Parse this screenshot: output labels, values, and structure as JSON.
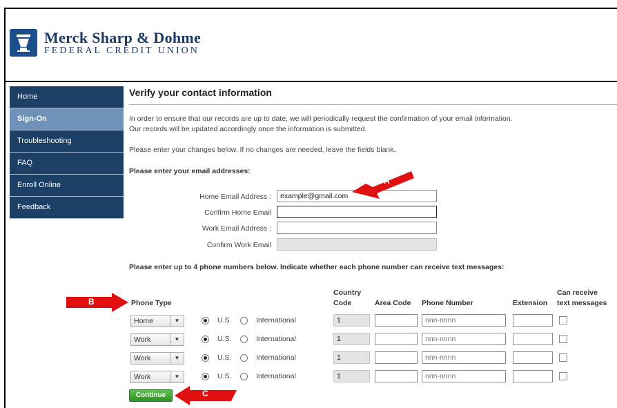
{
  "brand": {
    "name": "Merck Sharp & Dohme",
    "subtitle": "FEDERAL CREDIT UNION"
  },
  "sidebar": {
    "items": [
      {
        "label": "Home"
      },
      {
        "label": "Sign-On"
      },
      {
        "label": "Troubleshooting"
      },
      {
        "label": "FAQ"
      },
      {
        "label": "Enroll Online"
      },
      {
        "label": "Feedback"
      }
    ],
    "active_index": 1
  },
  "main": {
    "title": "Verify your contact information",
    "intro_line1": "In order to ensure that our records are up to date, we will periodically request the confirmation of your email information.",
    "intro_line2": "Our records will be updated accordingly once the information is submitted.",
    "instruction": "Please enter your changes below. If no changes are needed, leave the fields blank.",
    "email_heading": "Please enter your email addresses:",
    "email_fields": [
      {
        "label": "Home Email Address :",
        "value": "example@gmail.com"
      },
      {
        "label": "Confirm Home Email",
        "value": ""
      },
      {
        "label": "Work Email Address :",
        "value": ""
      },
      {
        "label": "Confirm Work Email",
        "value": ""
      }
    ],
    "phone_heading": "Please enter up to 4 phone numbers below. Indicate whether each phone number can receive text messages:",
    "phone_columns": {
      "type": "Phone Type",
      "country_1": "Country",
      "country_2": "Code",
      "area": "Area Code",
      "number": "Phone Number",
      "extension": "Extension",
      "text_1": "Can receive",
      "text_2": "text messages"
    },
    "phone_rows": [
      {
        "type": "Home",
        "us": "U.S.",
        "intl": "International",
        "country_code": "1",
        "number_placeholder": "nnn-nnnn"
      },
      {
        "type": "Work",
        "us": "U.S.",
        "intl": "International",
        "country_code": "1",
        "number_placeholder": "nnn-nnnn"
      },
      {
        "type": "Work",
        "us": "U.S.",
        "intl": "International",
        "country_code": "1",
        "number_placeholder": "nnn-nnnn"
      },
      {
        "type": "Work",
        "us": "U.S.",
        "intl": "International",
        "country_code": "1",
        "number_placeholder": "nnn-nnnn"
      }
    ],
    "continue_label": "Continue"
  },
  "annotations": {
    "a": "A",
    "b": "B",
    "c": "C",
    "color": "#e01010"
  },
  "colors": {
    "nav": "#1c3f66",
    "nav_active": "#6f93b8",
    "button": "#3a9a2e",
    "brand": "#1b3a66"
  }
}
